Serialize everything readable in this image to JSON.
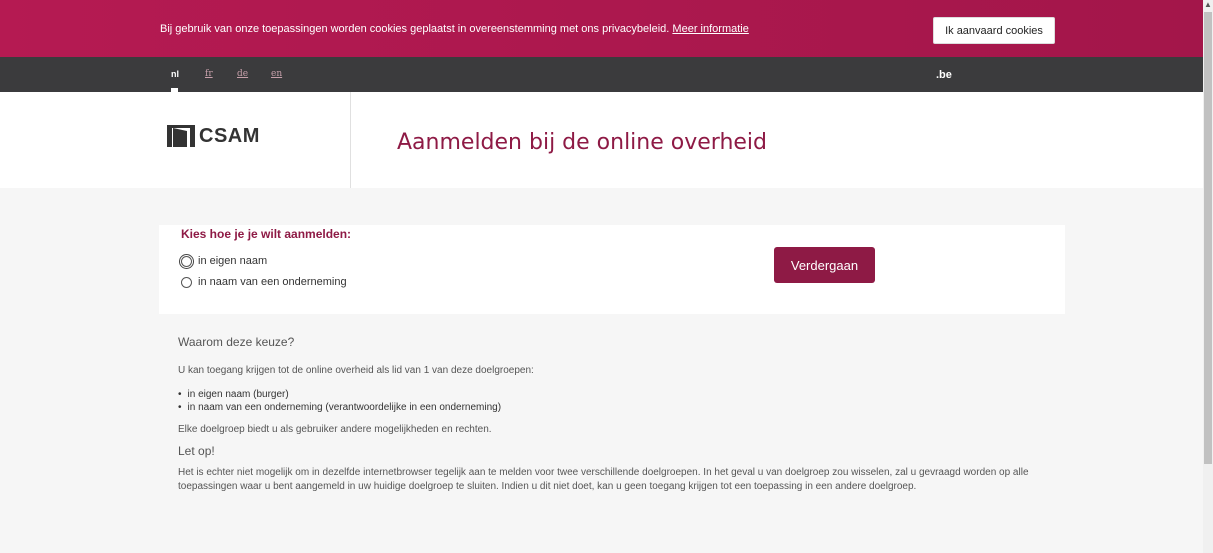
{
  "cookie": {
    "text": "Bij gebruik van onze toepassingen worden cookies geplaatst in overeenstemming met ons privacybeleid.",
    "link": "Meer informatie",
    "accept_label": "Ik aanvaard cookies"
  },
  "languages": [
    {
      "code": "nl",
      "active": true
    },
    {
      "code": "fr",
      "active": false
    },
    {
      "code": "de",
      "active": false
    },
    {
      "code": "en",
      "active": false
    }
  ],
  "be_logo": ".be",
  "header": {
    "logo_text": "CSAM",
    "title": "Aanmelden bij de online overheid"
  },
  "choice": {
    "heading": "Kies hoe je je wilt aanmelden:",
    "options": [
      "in eigen naam",
      "in naam van een onderneming"
    ],
    "continue_label": "Verdergaan"
  },
  "info": {
    "heading": "Waarom deze keuze?",
    "intro": "U kan toegang krijgen tot de online overheid als lid van 1 van deze doelgroepen:",
    "groups": [
      "in eigen naam (burger)",
      "in naam van een onderneming (verantwoordelijke in een onderneming)"
    ],
    "rights": "Elke doelgroep biedt u als gebruiker andere mogelijkheden en rechten.",
    "warning_heading": "Let op!",
    "warning": "Het is echter niet mogelijk om in dezelfde internetbrowser tegelijk aan te melden voor twee verschillende doelgroepen. In het geval u van doelgroep zou wisselen, zal u gevraagd worden op alle toepassingen waar u bent aangemeld in uw huidige doelgroep te sluiten. Indien u dit niet doet, kan u geen toegang krijgen tot een toepassing in een andere doelgroep."
  },
  "colors": {
    "brand": "#8e1a45",
    "cookie_bar": "#b51a52",
    "lang_bar": "#3b3b3d"
  }
}
